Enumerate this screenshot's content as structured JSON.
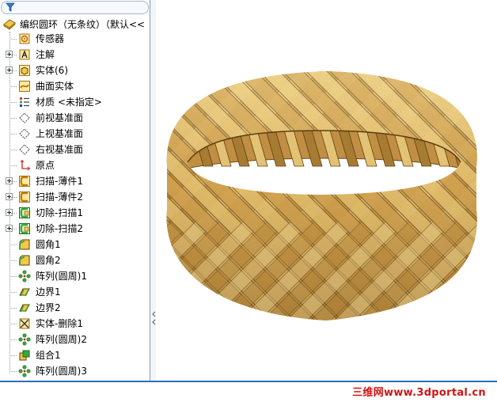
{
  "feature_tree": {
    "filter_icon": "filter-icon",
    "root_label": "编织圆环（无条纹）（默认<<",
    "items": [
      {
        "label": "传感器",
        "icon": "sensor-icon",
        "expandable": false
      },
      {
        "label": "注解",
        "icon": "annotation-icon",
        "expandable": true
      },
      {
        "label": "实体(6)",
        "icon": "solid-bodies-icon",
        "expandable": true
      },
      {
        "label": "曲面实体",
        "icon": "surface-bodies-icon",
        "expandable": false
      },
      {
        "label": "材质 <未指定>",
        "icon": "material-icon",
        "expandable": false
      },
      {
        "label": "前视基准面",
        "icon": "plane-icon",
        "expandable": false
      },
      {
        "label": "上视基准面",
        "icon": "plane-icon",
        "expandable": false
      },
      {
        "label": "右视基准面",
        "icon": "plane-icon",
        "expandable": false
      },
      {
        "label": "原点",
        "icon": "origin-icon",
        "expandable": false
      },
      {
        "label": "扫描-薄件1",
        "icon": "sweep-icon",
        "expandable": true
      },
      {
        "label": "扫描-薄件2",
        "icon": "sweep-icon",
        "expandable": true
      },
      {
        "label": "切除-扫描1",
        "icon": "cut-sweep-icon",
        "expandable": true
      },
      {
        "label": "切除-扫描2",
        "icon": "cut-sweep-icon",
        "expandable": true
      },
      {
        "label": "圆角1",
        "icon": "fillet-icon",
        "expandable": false
      },
      {
        "label": "圆角2",
        "icon": "fillet-icon",
        "expandable": false
      },
      {
        "label": "阵列(圆周)1",
        "icon": "circular-pattern-icon",
        "expandable": false
      },
      {
        "label": "边界1",
        "icon": "boundary-icon",
        "expandable": false
      },
      {
        "label": "边界2",
        "icon": "boundary-icon",
        "expandable": false
      },
      {
        "label": "实体-删除1",
        "icon": "delete-body-icon",
        "expandable": false
      },
      {
        "label": "阵列(圆周)2",
        "icon": "circular-pattern-icon",
        "expandable": false
      },
      {
        "label": "组合1",
        "icon": "combine-icon",
        "expandable": false
      },
      {
        "label": "阵列(圆周)3",
        "icon": "circular-pattern-icon",
        "expandable": false
      }
    ]
  },
  "viewport": {
    "model": "woven-gold-ring",
    "gold_light": "#f3dc9a",
    "gold_mid": "#c89a45",
    "gold_dark": "#6a4716"
  },
  "watermark": "三维网www.3dportal.cn",
  "colors": {
    "panel_border": "#7f9db9",
    "accent_blue": "#2b6db6",
    "watermark_red": "#d21414"
  }
}
